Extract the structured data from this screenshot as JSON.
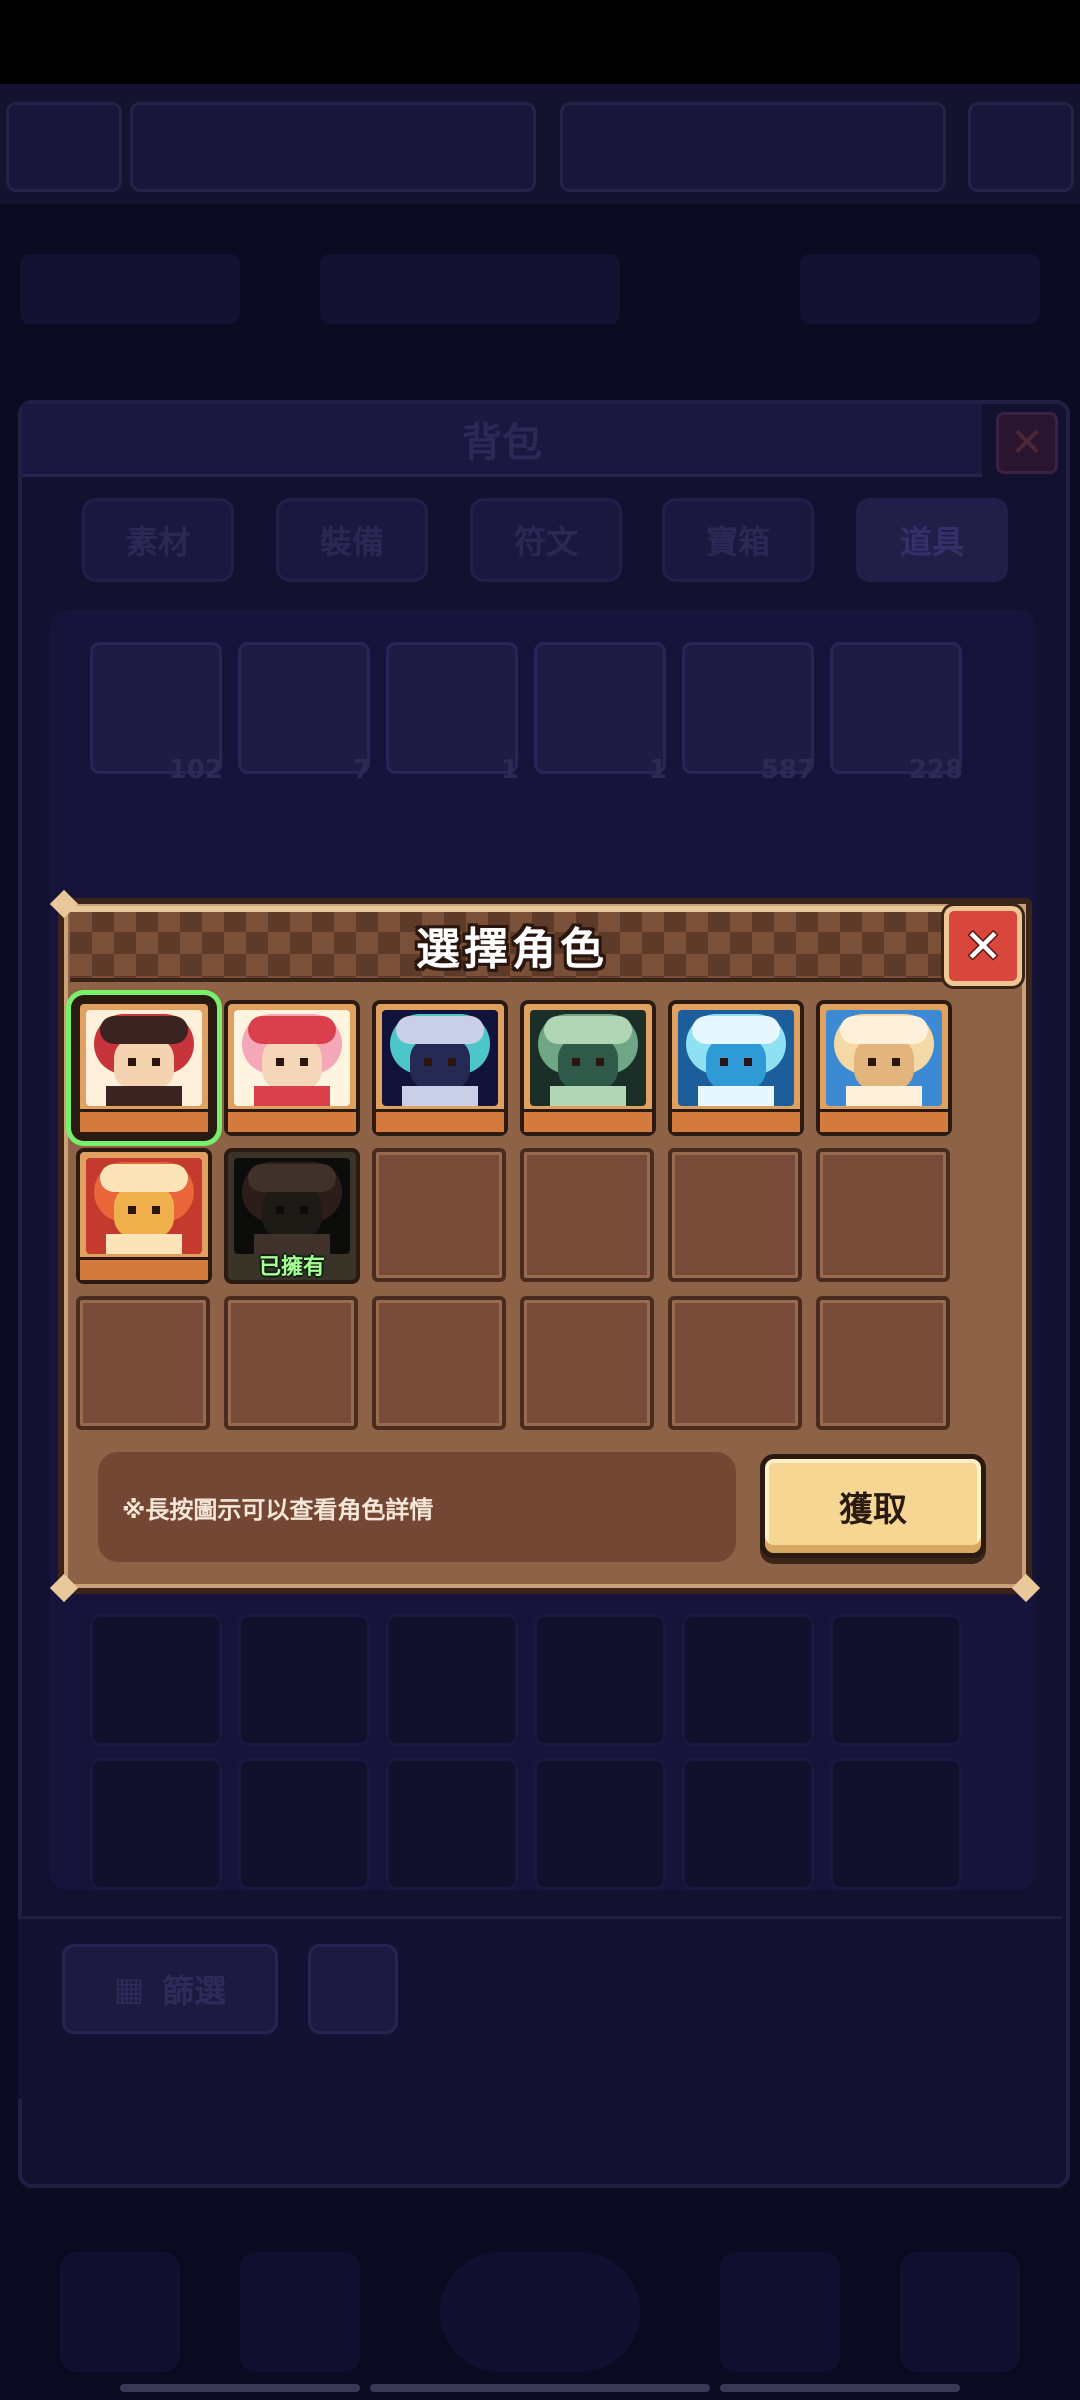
{
  "background": {
    "bag_title": "背包",
    "tabs": [
      "素材",
      "裝備",
      "符文",
      "寶箱",
      "道具"
    ],
    "active_tab_index": 4,
    "item_counts": [
      "102",
      "7",
      "1",
      "1",
      "587",
      "228"
    ],
    "filter_label": "篩選"
  },
  "dialog": {
    "title": "選擇角色",
    "close_symbol": "✕",
    "characters": [
      {
        "icon": "character-portrait-icon",
        "owned": false,
        "selected": true,
        "palette": [
          "#f3d3b0",
          "#c7343b",
          "#3a2320",
          "#fff0dc"
        ]
      },
      {
        "icon": "character-portrait-icon",
        "owned": false,
        "selected": false,
        "palette": [
          "#f5d6b8",
          "#f4a7b6",
          "#d9404c",
          "#fff4e0"
        ]
      },
      {
        "icon": "character-portrait-icon",
        "owned": false,
        "selected": false,
        "palette": [
          "#252a55",
          "#4cc6c9",
          "#c9cfe6",
          "#11133a"
        ]
      },
      {
        "icon": "character-portrait-icon",
        "owned": false,
        "selected": false,
        "palette": [
          "#2f5a4a",
          "#6fa786",
          "#b0d6b6",
          "#1b2f28"
        ]
      },
      {
        "icon": "character-portrait-icon",
        "owned": false,
        "selected": false,
        "palette": [
          "#2f9bd6",
          "#8fe0f3",
          "#e6f7ff",
          "#1d5d9a"
        ]
      },
      {
        "icon": "character-portrait-icon",
        "owned": false,
        "selected": false,
        "palette": [
          "#e2b57c",
          "#f4d9a6",
          "#fff0dc",
          "#3d8ad4"
        ]
      },
      {
        "icon": "character-portrait-icon",
        "owned": false,
        "selected": false,
        "palette": [
          "#f0b04c",
          "#e8663a",
          "#fbe4b8",
          "#c43a2c"
        ]
      },
      {
        "icon": "character-portrait-icon",
        "owned": true,
        "selected": false,
        "owned_label": "已擁有",
        "palette": [
          "#4a3a2c",
          "#7d3a30",
          "#a86a4c",
          "#1d1a14"
        ]
      }
    ],
    "empty_slot_count": 10,
    "hint": "※長按圖示可以查看角色詳情",
    "obtain_button": "獲取"
  },
  "colors": {
    "selected_outline": "#79f06c",
    "owned_text": "#a8ff95",
    "button_fill": "#f6d693",
    "close_red": "#d8463c"
  }
}
